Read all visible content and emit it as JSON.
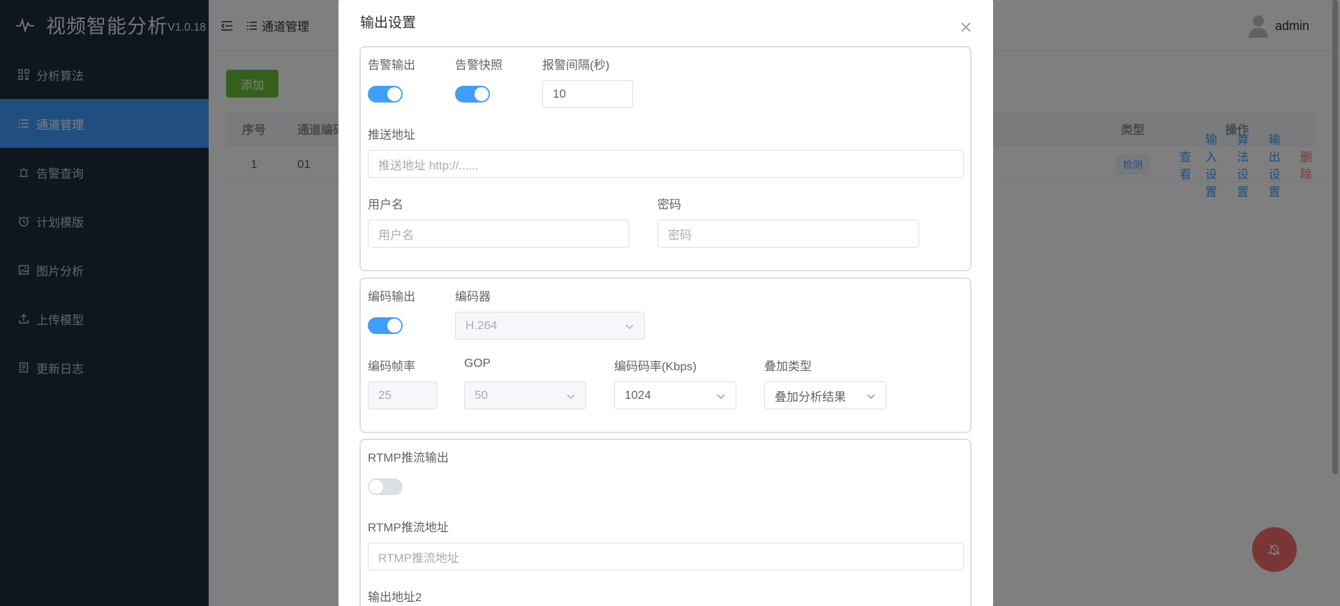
{
  "app": {
    "name": "视频智能分析",
    "version": "V1.0.18"
  },
  "sidebar": {
    "items": [
      {
        "label": "分析算法",
        "icon": "grid-icon"
      },
      {
        "label": "通道管理",
        "icon": "list-icon"
      },
      {
        "label": "告警查询",
        "icon": "alarm-light-icon"
      },
      {
        "label": "计划模版",
        "icon": "clock-icon"
      },
      {
        "label": "图片分析",
        "icon": "image-icon"
      },
      {
        "label": "上传模型",
        "icon": "upload-icon"
      },
      {
        "label": "更新日志",
        "icon": "document-icon"
      }
    ],
    "active_index": 1
  },
  "header": {
    "breadcrumb": "通道管理",
    "username": "admin"
  },
  "main": {
    "add_button": "添加",
    "table": {
      "headers": {
        "index": "序号",
        "channel_code": "通道编码",
        "type": "类型",
        "ops": "操作"
      },
      "rows": [
        {
          "index": "1",
          "channel_code": "01",
          "type_tag": "检测"
        }
      ],
      "ops": {
        "view": "查看",
        "input": "输入设置",
        "algo": "算法设置",
        "output": "输出设置",
        "delete": "删除"
      }
    }
  },
  "dialog": {
    "title": "输出设置",
    "alarm": {
      "alarm_output_label": "告警输出",
      "alarm_output_on": true,
      "alarm_snapshot_label": "告警快照",
      "alarm_snapshot_on": true,
      "interval_label": "报警间隔(秒)",
      "interval_value": "10",
      "push_url_label": "推送地址",
      "push_url_placeholder": "推送地址 http://......",
      "username_label": "用户名",
      "username_placeholder": "用户名",
      "password_label": "密码",
      "password_placeholder": "密码"
    },
    "encode": {
      "encode_output_label": "编码输出",
      "encode_output_on": true,
      "encoder_label": "编码器",
      "encoder_value": "H.264",
      "fps_label": "编码帧率",
      "fps_value": "25",
      "gop_label": "GOP",
      "gop_value": "50",
      "bitrate_label": "编码码率(Kbps)",
      "bitrate_value": "1024",
      "overlay_label": "叠加类型",
      "overlay_value": "叠加分析结果"
    },
    "rtmp": {
      "rtmp_output_label": "RTMP推流输出",
      "rtmp_output_on": false,
      "rtmp_url_label": "RTMP推流地址",
      "rtmp_url_placeholder": "RTMP推流地址",
      "output2_label": "输出地址2"
    }
  },
  "colors": {
    "sidebar_bg": "#1f2d3d",
    "active": "#409eff",
    "add_button": "#67c23a",
    "danger": "#f56c6c"
  }
}
